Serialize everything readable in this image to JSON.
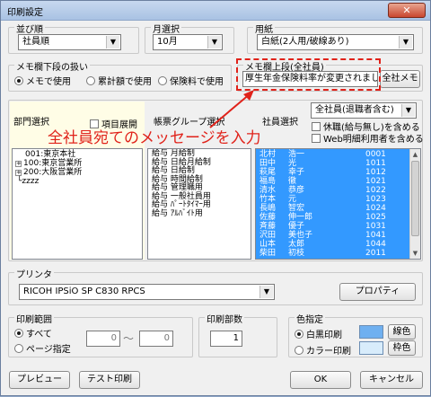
{
  "window": {
    "title": "印刷設定",
    "close_label": "✕"
  },
  "sort": {
    "label": "並び順",
    "value": "社員順"
  },
  "month": {
    "label": "月選択",
    "value": "10月"
  },
  "paper": {
    "label": "用紙",
    "value": "白紙(2人用/破線あり)"
  },
  "lower_memo": {
    "label": "メモ欄下段の扱い",
    "options": [
      "メモで使用",
      "累計額で使用",
      "保険料で使用"
    ],
    "selected": 0
  },
  "upper_memo": {
    "label": "メモ欄上段(全社員)",
    "value": "厚生年金保険料率が変更されました。",
    "button": "全社メモ"
  },
  "dept": {
    "label": "部門選択",
    "expand_label": "項目展開",
    "items": [
      {
        "code": "001",
        "name": "東京本社",
        "expander": "",
        "line": ""
      },
      {
        "code": "100",
        "name": "東京営業所",
        "expander": "+",
        "line": ""
      },
      {
        "code": "200",
        "name": "大阪営業所",
        "expander": "+",
        "line": ""
      },
      {
        "code": "",
        "name": "zzzz",
        "expander": "",
        "line": "└"
      }
    ]
  },
  "forms": {
    "label": "帳票グループ選択",
    "items": [
      {
        "a": "給与",
        "b": "月給制"
      },
      {
        "a": "給与",
        "b": "日給月給制"
      },
      {
        "a": "給与",
        "b": "日給制"
      },
      {
        "a": "給与",
        "b": "時間給制"
      },
      {
        "a": "給与",
        "b": "管理職用"
      },
      {
        "a": "給与",
        "b": "一般社員用"
      },
      {
        "a": "給与",
        "b": "ﾊﾟｰﾄﾀｲﾏｰ用"
      },
      {
        "a": "給与",
        "b": "ｱﾙﾊﾞｲﾄ用"
      }
    ]
  },
  "employees": {
    "label": "社員選択",
    "filter": "全社員(退職者含む)",
    "check1": "休職(給与無し)を含める",
    "check2": "Web明細利用者を含める",
    "rows": [
      {
        "last": "北村",
        "first": "浩一",
        "code": "0001"
      },
      {
        "last": "田中",
        "first": "光",
        "code": "1011"
      },
      {
        "last": "萩尾",
        "first": "幸子",
        "code": "1012"
      },
      {
        "last": "福島",
        "first": "徹",
        "code": "1021"
      },
      {
        "last": "清水",
        "first": "恭彦",
        "code": "1022"
      },
      {
        "last": "竹本",
        "first": "元",
        "code": "1023"
      },
      {
        "last": "長嶋",
        "first": "智宏",
        "code": "1024"
      },
      {
        "last": "佐藤",
        "first": "伸一郎",
        "code": "1025"
      },
      {
        "last": "斉藤",
        "first": "優子",
        "code": "1031"
      },
      {
        "last": "沢田",
        "first": "美也子",
        "code": "1041"
      },
      {
        "last": "山本",
        "first": "太郎",
        "code": "1044"
      },
      {
        "last": "柴田",
        "first": "初枝",
        "code": "2011"
      }
    ]
  },
  "annotation": {
    "text": "全社員宛てのメッセージを入力",
    "color": "#e0221a"
  },
  "printer": {
    "label": "プリンタ",
    "value": "RICOH IPSiO SP C830 RPCS",
    "properties_button": "プロパティ"
  },
  "range": {
    "label": "印刷範囲",
    "options": [
      "すべて",
      "ページ指定"
    ],
    "selected": 0,
    "from": "0",
    "to": "0",
    "separator": "〜"
  },
  "copies": {
    "label": "印刷部数",
    "value": "1"
  },
  "color_spec": {
    "label": "色指定",
    "options": [
      "白黒印刷",
      "カラー印刷"
    ],
    "selected": 0,
    "line_color_label": "線色",
    "frame_color_label": "枠色",
    "line_color": "#6fb0f0",
    "frame_color": "#d8ecfb"
  },
  "buttons": {
    "preview": "プレビュー",
    "test_print": "テスト印刷",
    "ok": "OK",
    "cancel": "キャンセル"
  },
  "colors": {
    "selection": "#3399ff",
    "dept_panel": "#fffde6",
    "annotation": "#e0221a"
  }
}
